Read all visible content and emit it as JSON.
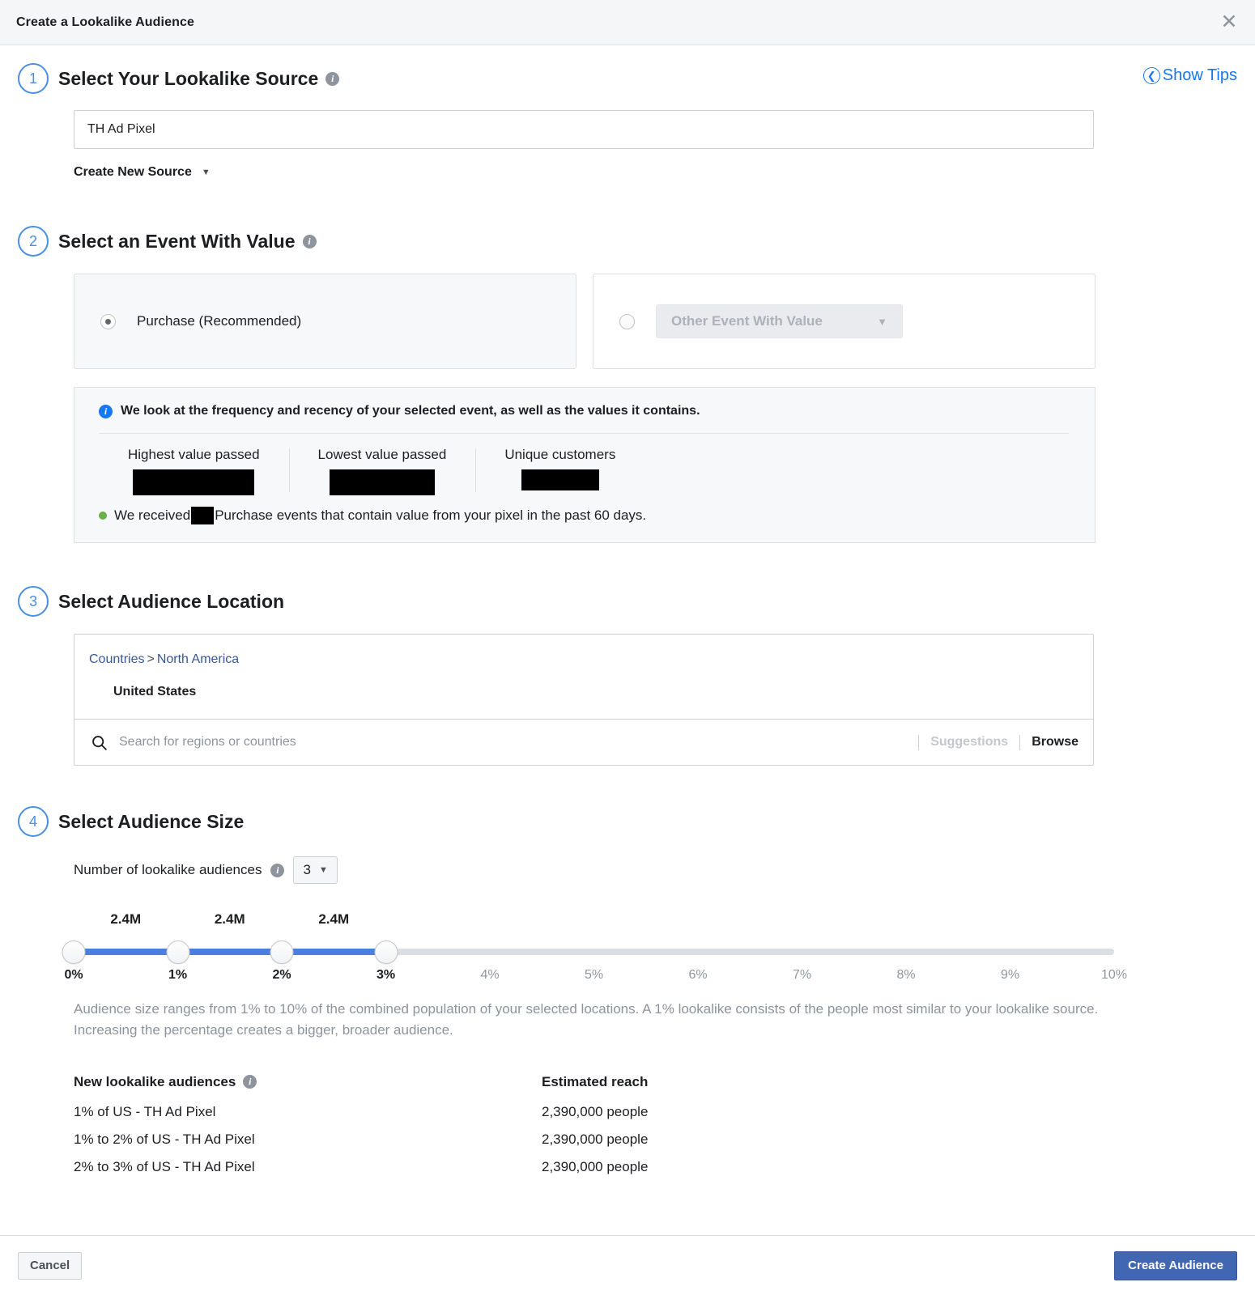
{
  "dialog": {
    "title": "Create a Lookalike Audience",
    "close_icon": "close-icon"
  },
  "show_tips": {
    "label": "Show Tips",
    "chevron": "‹"
  },
  "section1": {
    "number": "1",
    "title": "Select Your Lookalike Source",
    "source_value": "TH Ad Pixel",
    "create_new_source": "Create New Source",
    "caret": "▼"
  },
  "section2": {
    "number": "2",
    "title": "Select an Event With Value",
    "option_purchase": "Purchase (Recommended)",
    "option_other": "Other Event With Value",
    "other_caret": "▼",
    "info_text": "We look at the frequency and recency of your selected event, as well as the values it contains.",
    "metrics": [
      {
        "label": "Highest value passed",
        "value_redacted": true,
        "redact_w": 150,
        "redact_h": 32
      },
      {
        "label": "Lowest value passed",
        "value_redacted": true,
        "redact_w": 130,
        "redact_h": 32
      },
      {
        "label": "Unique customers",
        "value_redacted": true,
        "redact_w": 96,
        "redact_h": 26
      }
    ],
    "status_prefix": "We received",
    "status_suffix": "Purchase events that contain value from your pixel in the past 60 days."
  },
  "section3": {
    "number": "3",
    "title": "Select Audience Location",
    "breadcrumb_root": "Countries",
    "breadcrumb_sep": ">",
    "breadcrumb_current": "North America",
    "selected_country": "United States",
    "search_placeholder": "Search for regions or countries",
    "suggestions_label": "Suggestions",
    "browse_label": "Browse"
  },
  "section4": {
    "number": "4",
    "title": "Select Audience Size",
    "num_label": "Number of lookalike audiences",
    "num_value": "3",
    "caret": "▼",
    "description": "Audience size ranges from 1% to 10% of the combined population of your selected locations. A 1% lookalike consists of the people most similar to your lookalike source. Increasing the percentage creates a bigger, broader audience.",
    "table_head_left": "New lookalike audiences",
    "table_head_right": "Estimated reach",
    "rows": [
      {
        "name": "1% of US - TH Ad Pixel",
        "reach": "2,390,000 people"
      },
      {
        "name": "1% to 2% of US - TH Ad Pixel",
        "reach": "2,390,000 people"
      },
      {
        "name": "2% to 3% of US - TH Ad Pixel",
        "reach": "2,390,000 people"
      }
    ]
  },
  "slider": {
    "min_percent": 0,
    "max_percent": 10,
    "selected_percent": 3,
    "knob_positions": [
      0,
      1,
      2,
      3
    ],
    "segment_values": [
      "2.4M",
      "2.4M",
      "2.4M"
    ],
    "ticks": [
      {
        "label": "0%",
        "value": 0,
        "active": true
      },
      {
        "label": "1%",
        "value": 1,
        "active": true
      },
      {
        "label": "2%",
        "value": 2,
        "active": true
      },
      {
        "label": "3%",
        "value": 3,
        "active": true
      },
      {
        "label": "4%",
        "value": 4,
        "active": false
      },
      {
        "label": "5%",
        "value": 5,
        "active": false
      },
      {
        "label": "6%",
        "value": 6,
        "active": false
      },
      {
        "label": "7%",
        "value": 7,
        "active": false
      },
      {
        "label": "8%",
        "value": 8,
        "active": false
      },
      {
        "label": "9%",
        "value": 9,
        "active": false
      },
      {
        "label": "10%",
        "value": 10,
        "active": false
      }
    ],
    "fill_color": "#4a7fe0",
    "track_color": "#dcdee3"
  },
  "footer": {
    "cancel": "Cancel",
    "primary": "Create Audience"
  },
  "colors": {
    "accent_blue": "#1877f2",
    "primary_button": "#4267b2",
    "step_badge": "#4a90e2",
    "link": "#385898"
  }
}
